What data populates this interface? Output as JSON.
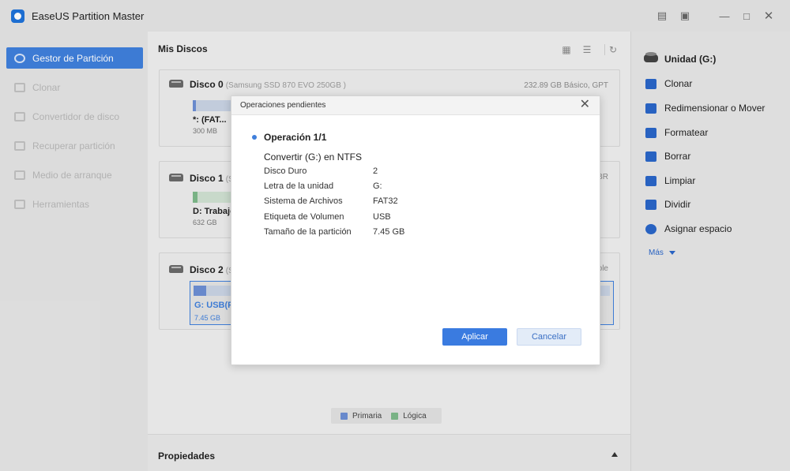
{
  "app": {
    "title": "EaseUS Partition Master"
  },
  "titlebar": {
    "icons": [
      "feedback-icon",
      "pin-icon",
      "minimize-icon",
      "maximize-icon",
      "close-icon"
    ]
  },
  "sidebar": {
    "items": [
      {
        "label": "Gestor de Partición",
        "active": true
      },
      {
        "label": "Clonar"
      },
      {
        "label": "Convertidor de disco"
      },
      {
        "label": "Recuperar partición"
      },
      {
        "label": "Medio de arranque"
      },
      {
        "label": "Herramientas"
      }
    ]
  },
  "main": {
    "title": "Mis Discos",
    "disks": [
      {
        "name": "Disco 0",
        "model": "(Samsung SSD 870 EVO 250GB )",
        "info": "232.89 GB Básico, GPT",
        "partition": {
          "label": "*: (FAT...",
          "size": "300 MB"
        }
      },
      {
        "name": "Disco 1",
        "model": "(ST",
        "info": "BR",
        "partition": {
          "label": "D: Trabajo",
          "size": "632 GB"
        }
      },
      {
        "name": "Disco 2",
        "model": "(Sa",
        "info": "ble",
        "partition": {
          "label": "G: USB(FA",
          "size": "7.45 GB"
        }
      }
    ],
    "legend": {
      "primary": "Primaria",
      "logical": "Lógica"
    },
    "properties": "Propiedades"
  },
  "rightpanel": {
    "title": "Unidad (G:)",
    "actions": [
      "Clonar",
      "Redimensionar o Mover",
      "Formatear",
      "Borrar",
      "Limpiar",
      "Dividir",
      "Asignar espacio"
    ],
    "more": "Más"
  },
  "dialog": {
    "title": "Operaciones pendientes",
    "op_title": "Operación 1/1",
    "op_action": "Convertir (G:) en NTFS",
    "rows": [
      {
        "key": "Disco Duro",
        "value": "2"
      },
      {
        "key": "Letra de la unidad",
        "value": "G:"
      },
      {
        "key": "Sistema de Archivos",
        "value": "FAT32"
      },
      {
        "key": "Etiqueta de Volumen",
        "value": "USB"
      },
      {
        "key": "Tamaño de la partición",
        "value": "7.45 GB"
      }
    ],
    "apply": "Aplicar",
    "cancel": "Cancelar"
  },
  "colors": {
    "accent": "#3f7fdb",
    "primary_part": "#6c8ed3",
    "logical_part": "#7db88a"
  }
}
